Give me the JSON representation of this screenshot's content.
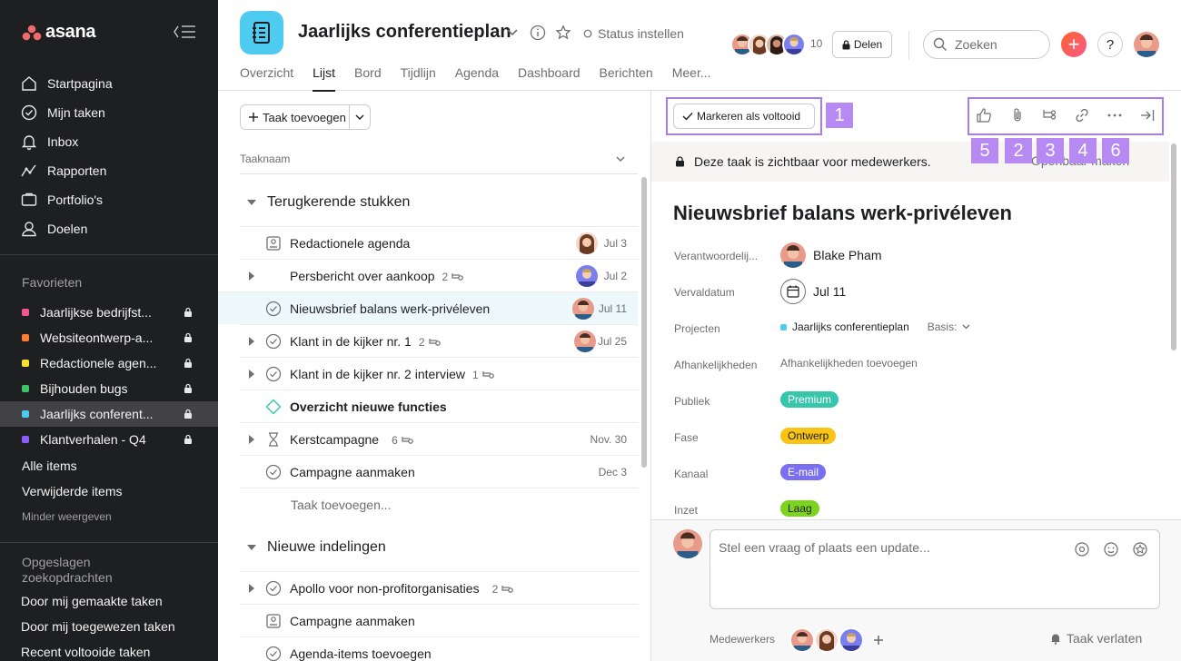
{
  "sidebar": {
    "logo": "asana",
    "nav": [
      {
        "label": "Startpagina",
        "icon": "home-icon"
      },
      {
        "label": "Mijn taken",
        "icon": "check-circle-icon"
      },
      {
        "label": "Inbox",
        "icon": "bell-icon"
      },
      {
        "label": "Rapporten",
        "icon": "chart-line-icon"
      },
      {
        "label": "Portfolio's",
        "icon": "folder-icon"
      },
      {
        "label": "Doelen",
        "icon": "person-icon"
      }
    ],
    "favorites_title": "Favorieten",
    "favorites": [
      {
        "label": "Jaarlijkse bedrijfst...",
        "color": "#f9558d"
      },
      {
        "label": "Websiteontwerp-a...",
        "color": "#fd7e30"
      },
      {
        "label": "Redactionele agen...",
        "color": "#f8df2f"
      },
      {
        "label": "Bijhouden bugs",
        "color": "#3cc36a"
      },
      {
        "label": "Jaarlijks conferent...",
        "color": "#4ecbf0"
      },
      {
        "label": "Klantverhalen - Q4",
        "color": "#8d5ef7"
      }
    ],
    "all_items": "Alle items",
    "deleted_items": "Verwijderde items",
    "show_less": "Minder weergeven",
    "saved_title_1": "Opgeslagen",
    "saved_title_2": "zoekopdrachten",
    "saved": [
      "Door mij gemaakte taken",
      "Door mij toegewezen taken",
      "Recent voltooide taken"
    ]
  },
  "header": {
    "project_title": "Jaarlijks conferentieplan",
    "status": "Status instellen",
    "member_count": "10",
    "share": "Delen",
    "search_placeholder": "Zoeken",
    "help": "?",
    "tabs": [
      "Overzicht",
      "Lijst",
      "Bord",
      "Tijdlijn",
      "Agenda",
      "Dashboard",
      "Berichten",
      "Meer..."
    ],
    "active_tab": "Lijst"
  },
  "list": {
    "add_task": "Taak toevoegen",
    "column_taskname": "Taaknaam",
    "add_in_section": "Taak toevoegen...",
    "sections": [
      {
        "name": "Terugkerende stukken",
        "tasks": [
          {
            "name": "Redactionele agenda",
            "icon": "approval-icon",
            "subtasks": "",
            "date": "Jul 3",
            "assignee": true
          },
          {
            "name": "Persbericht over aankoop",
            "icon": "",
            "subtasks": "2",
            "date": "Jul 2",
            "assignee": true,
            "expand": true
          },
          {
            "name": "Nieuwsbrief balans werk-privéleven",
            "icon": "check-circle-icon",
            "subtasks": "",
            "date": "Jul 11",
            "assignee": true,
            "selected": true
          },
          {
            "name": "Klant in de kijker nr. 1",
            "icon": "check-circle-icon",
            "subtasks": "2",
            "date": "Jul 25",
            "assignee": true,
            "expand": true
          },
          {
            "name": "Klant in de kijker nr. 2 interview",
            "icon": "check-circle-icon",
            "subtasks": "1",
            "date": "",
            "assignee": false,
            "expand": true
          },
          {
            "name": "Overzicht nieuwe functies",
            "icon": "milestone-icon",
            "subtasks": "",
            "date": "",
            "assignee": false,
            "bold": true
          },
          {
            "name": "Kerstcampagne",
            "icon": "hourglass-icon",
            "subtasks": "6",
            "date": "Nov. 30",
            "assignee": false,
            "expand": true
          },
          {
            "name": "Campagne aanmaken",
            "icon": "check-circle-icon",
            "subtasks": "",
            "date": "Dec 3",
            "assignee": false
          }
        ]
      },
      {
        "name": "Nieuwe indelingen",
        "tasks": [
          {
            "name": "Apollo voor non-profitorganisaties",
            "icon": "check-circle-icon",
            "subtasks": "2",
            "date": "",
            "expand": true
          },
          {
            "name": "Campagne aanmaken",
            "icon": "approval-icon",
            "subtasks": "",
            "date": ""
          },
          {
            "name": "Agenda-items toevoegen",
            "icon": "check-circle-icon",
            "subtasks": "",
            "date": ""
          }
        ]
      }
    ]
  },
  "detail": {
    "mark_complete": "Markeren als voltooid",
    "badges": [
      "1",
      "5",
      "2",
      "3",
      "4",
      "6"
    ],
    "visibility": "Deze taak is zichtbaar voor medewerkers.",
    "make_public": "Openbaar maken",
    "title": "Nieuwsbrief balans werk-privéleven",
    "fields": {
      "assignee_label": "Verantwoordelij...",
      "assignee": "Blake Pham",
      "due_label": "Vervaldatum",
      "due": "Jul 11",
      "projects_label": "Projecten",
      "project": "Jaarlijks conferentieplan",
      "project_section": "Basis:",
      "deps_label": "Afhankelijkheden",
      "deps_add": "Afhankelijkheden toevoegen",
      "audience_label": "Publiek",
      "audience": "Premium",
      "phase_label": "Fase",
      "phase": "Ontwerp",
      "channel_label": "Kanaal",
      "channel": "E-mail",
      "effort_label": "Inzet",
      "effort": "Laag"
    },
    "comment_placeholder": "Stel een vraag of plaats een update...",
    "collaborators_label": "Medewerkers",
    "leave_task": "Taak verlaten"
  },
  "colors": {
    "sidebar_bg": "#1e1f21",
    "highlight": "#a97bf2",
    "badge": "#b68af2",
    "premium": "#37c5ab",
    "ontwerp": "#f8c517",
    "email": "#7a6ff0",
    "laag": "#7ed321"
  }
}
